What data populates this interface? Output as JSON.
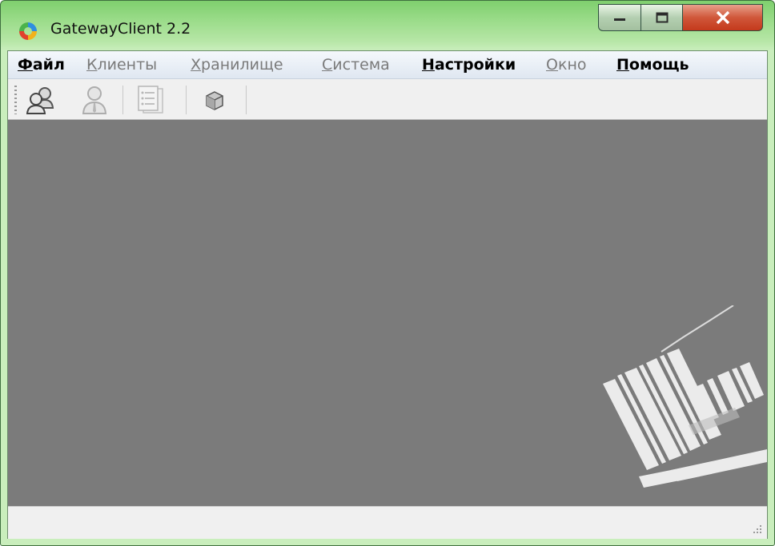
{
  "window": {
    "title": "GatewayClient 2.2",
    "accent_color": "#7fcf6e",
    "icons": {
      "app": "app-logo-icon",
      "minimize": "minimize-icon",
      "maximize": "maximize-icon",
      "close": "close-icon"
    }
  },
  "menu": {
    "items": [
      {
        "label": "Файл",
        "enabled": true
      },
      {
        "label": "Клиенты",
        "enabled": false
      },
      {
        "label": "Хранилище",
        "enabled": false
      },
      {
        "label": "Система",
        "enabled": false
      },
      {
        "label": "Настройки",
        "enabled": true
      },
      {
        "label": "Окно",
        "enabled": false
      },
      {
        "label": "Помощь",
        "enabled": true
      }
    ]
  },
  "toolbar": {
    "buttons": [
      {
        "icon": "users-icon",
        "enabled": true
      },
      {
        "icon": "user-icon",
        "enabled": false
      },
      {
        "icon": "list-document-icon",
        "enabled": false
      },
      {
        "icon": "package-box-icon",
        "enabled": true
      }
    ]
  },
  "workspace": {
    "background": "#7b7b7b",
    "decoration": "watermark-icon"
  },
  "statusbar": {
    "text": ""
  }
}
